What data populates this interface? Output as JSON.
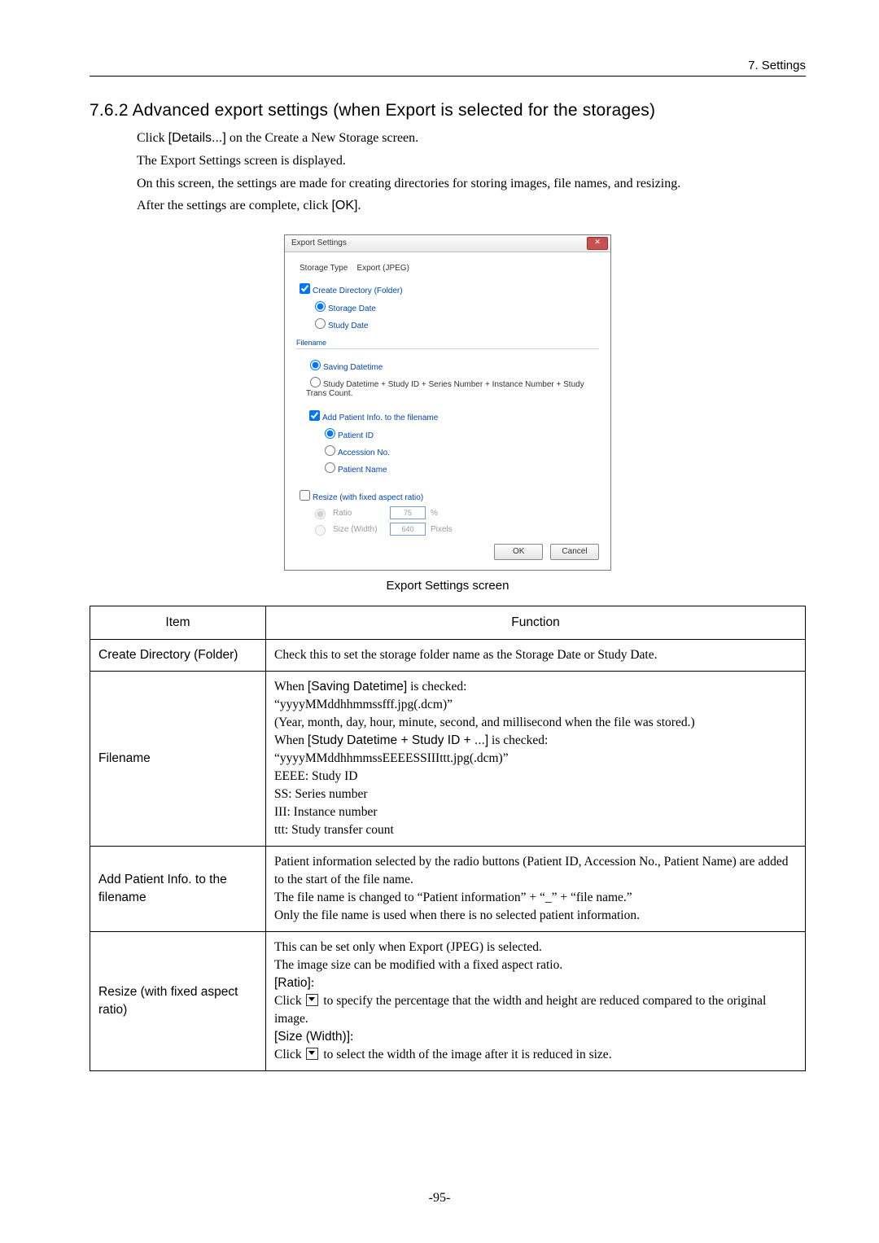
{
  "header": {
    "chapter": "7. Settings"
  },
  "heading": "7.6.2 Advanced export settings (when Export is selected for the storages)",
  "intro": {
    "l1a": "Click ",
    "l1b": "[Details...]",
    "l1c": " on the Create a New Storage screen.",
    "l2": "The Export Settings screen is displayed.",
    "l3": "On this screen, the settings are made for creating directories for storing images, file names, and resizing.",
    "l4a": "After the settings are complete, click ",
    "l4b": "[OK]",
    "l4c": "."
  },
  "dialog": {
    "title": "Export Settings",
    "type_label": "Storage Type",
    "type_value": "Export (JPEG)",
    "cd_check": "Create Directory (Folder)",
    "cd_r1": "Storage Date",
    "cd_r2": "Study Date",
    "fn_legend": "Filename",
    "fn_r1": "Saving Datetime",
    "fn_r2": "Study Datetime + Study ID + Series Number + Instance Number + Study Trans Count.",
    "fn_add": "Add Patient Info. to the filename",
    "fn_pid": "Patient ID",
    "fn_acc": "Accession No.",
    "fn_pname": "Patient Name",
    "rz_check": "Resize (with fixed aspect ratio)",
    "rz_ratio": "Ratio",
    "rz_ratio_val": "75",
    "rz_ratio_unit": "%",
    "rz_size": "Size (Width)",
    "rz_size_val": "640",
    "rz_size_unit": "Pixels",
    "ok": "OK",
    "cancel": "Cancel"
  },
  "figcaption": "Export Settings screen",
  "table": {
    "h1": "Item",
    "h2": "Function",
    "r1c1": "Create Directory (Folder)",
    "r1c2": "Check this to set the storage folder name as the Storage Date or Study Date.",
    "r2c1": "Filename",
    "r2": {
      "a": "When ",
      "b": "[Saving Datetime]",
      "c": " is checked:",
      "d": "“yyyyMMddhhmmssfff.jpg(.dcm)”",
      "e": "(Year, month, day, hour, minute, second, and millisecond when the file was stored.)",
      "f": "When ",
      "g": "[Study Datetime +  Study ID + ...]",
      "h": " is checked:",
      "i": "“yyyyMMddhhmmssEEEESSIIIttt.jpg(.dcm)”",
      "j": "EEEE: Study ID",
      "k": "SS: Series number",
      "l": "III: Instance number",
      "m": "ttt: Study transfer count"
    },
    "r3c1": "Add Patient Info. to the filename",
    "r3": {
      "a": "Patient information selected by the radio buttons (Patient ID, Accession No., Patient Name) are added to the start of the file name.",
      "b": "The file name is changed to “Patient information” + “_” + “file name.”",
      "c": "Only the file name is used when there is no selected patient information."
    },
    "r4c1": "Resize (with fixed aspect ratio)",
    "r4": {
      "a": "This can be set only when Export (JPEG) is selected.",
      "b": "The image size can be modified with a fixed aspect ratio.",
      "c": "[Ratio]",
      "cpost": ":",
      "d1": "Click ",
      "d2": " to specify the percentage that the width and height are reduced compared to the original image.",
      "e": "[Size (Width)]",
      "epost": ":",
      "f1": "Click ",
      "f2": " to select the width of the image after it is reduced in size."
    }
  },
  "pagenum": "-95-"
}
